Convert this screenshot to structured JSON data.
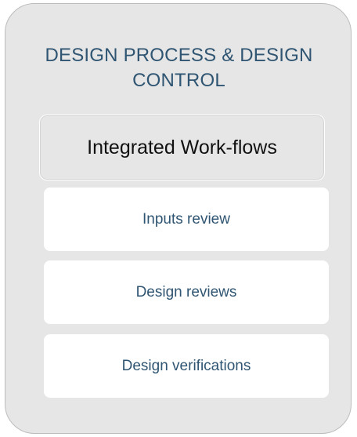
{
  "panel": {
    "title_line1": "DESIGN PROCESS & DESIGN",
    "title_line2": "CONTROL",
    "header": "Integrated Work-flows",
    "items": [
      {
        "label": "Inputs review"
      },
      {
        "label": "Design reviews"
      },
      {
        "label": "Design verifications"
      }
    ]
  }
}
